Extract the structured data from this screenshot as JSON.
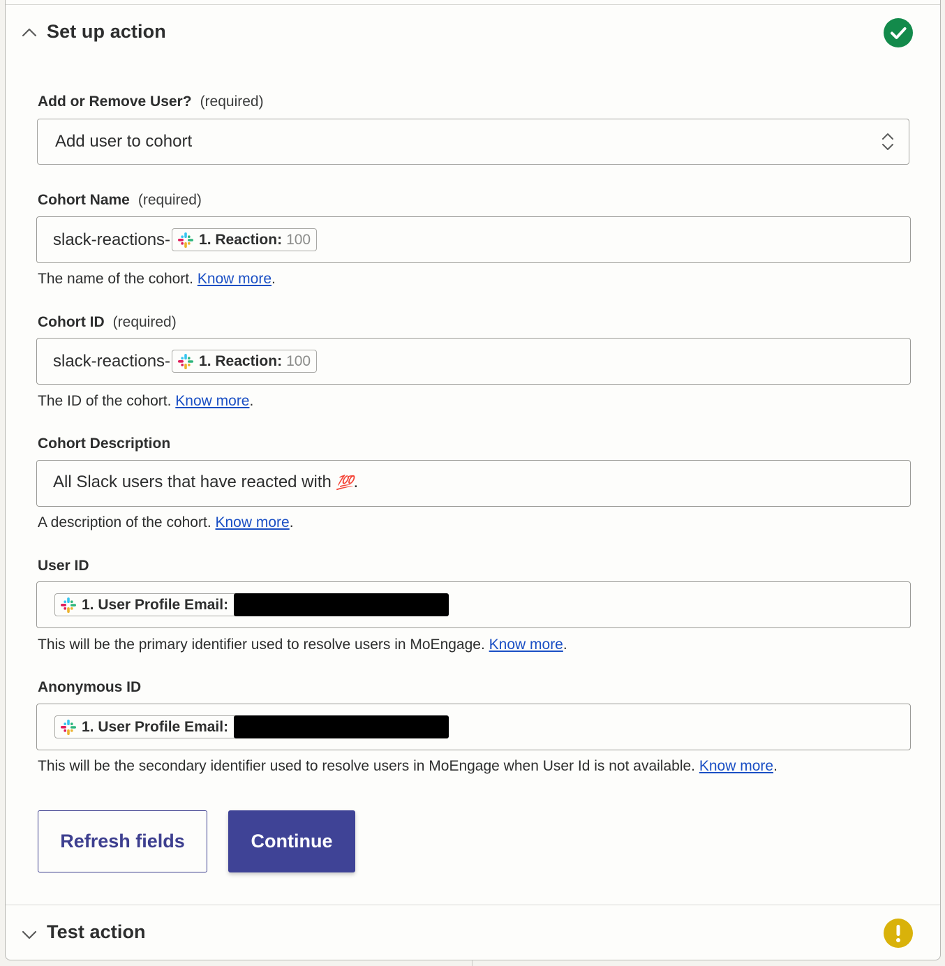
{
  "setup": {
    "title": "Set up action",
    "status_color": "#138a4b"
  },
  "fields": {
    "add_remove": {
      "label": "Add or Remove User?",
      "required": "(required)",
      "value": "Add user to cohort"
    },
    "cohort_name": {
      "label": "Cohort Name",
      "required": "(required)",
      "prefix": "slack-reactions-",
      "pill_label": "1. Reaction:",
      "pill_value": "100",
      "help": "The name of the cohort.",
      "link": "Know more"
    },
    "cohort_id": {
      "label": "Cohort ID",
      "required": "(required)",
      "prefix": "slack-reactions-",
      "pill_label": "1. Reaction:",
      "pill_value": "100",
      "help": "The ID of the cohort.",
      "link": "Know more"
    },
    "cohort_description": {
      "label": "Cohort Description",
      "value": "All Slack users that have reacted with",
      "emoji": "💯",
      "suffix": ".",
      "help": "A description of the cohort.",
      "link": "Know more"
    },
    "user_id": {
      "label": "User ID",
      "pill_label": "1. User Profile Email:",
      "help": "This will be the primary identifier used to resolve users in MoEngage.",
      "link": "Know more"
    },
    "anonymous_id": {
      "label": "Anonymous ID",
      "pill_label": "1. User Profile Email:",
      "help": "This will be the secondary identifier used to resolve users in MoEngage when User Id is not available.",
      "link": "Know more"
    }
  },
  "buttons": {
    "refresh": "Refresh fields",
    "continue": "Continue"
  },
  "test": {
    "title": "Test action",
    "status_color": "#d9b20a"
  }
}
